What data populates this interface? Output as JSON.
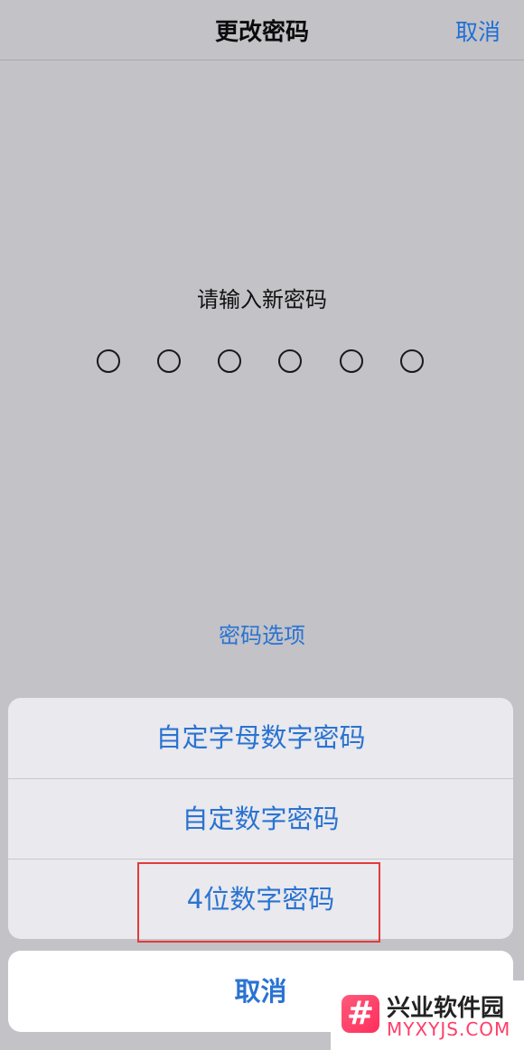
{
  "nav": {
    "title": "更改密码",
    "cancel_label": "取消"
  },
  "prompt": "请输入新密码",
  "passcode_dots_count": 6,
  "options_link": "密码选项",
  "sheet": {
    "items": [
      {
        "label": "自定字母数字密码"
      },
      {
        "label": "自定数字密码"
      },
      {
        "label": "4位数字密码"
      }
    ],
    "cancel_label": "取消"
  },
  "watermark": {
    "logo_glyph": "#",
    "name": "兴业软件园",
    "url": "MYXYJS.COM"
  },
  "colors": {
    "accent": "#2a73d1",
    "background": "#c2c2c7",
    "highlight": "#e33a3a"
  }
}
